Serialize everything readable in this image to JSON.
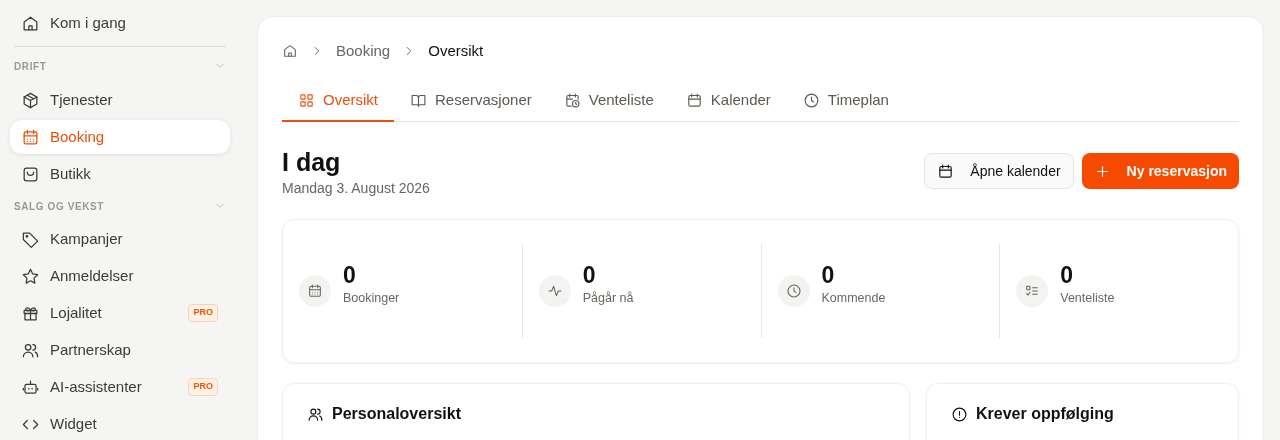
{
  "sidebar": {
    "top_items": [
      {
        "label": "Kom i gang",
        "selected": false
      }
    ],
    "sections": [
      {
        "heading": "DRIFT",
        "expanded": true,
        "items": [
          {
            "label": "Tjenester",
            "selected": false
          },
          {
            "label": "Booking",
            "selected": true
          },
          {
            "label": "Butikk",
            "selected": false
          }
        ]
      },
      {
        "heading": "SALG OG VEKST",
        "expanded": true,
        "items": [
          {
            "label": "Kampanjer",
            "selected": false
          },
          {
            "label": "Anmeldelser",
            "selected": false
          },
          {
            "label": "Lojalitet",
            "selected": false,
            "badge": "PRO"
          },
          {
            "label": "Partnerskap",
            "selected": false
          },
          {
            "label": "AI-assistenter",
            "selected": false,
            "badge": "PRO"
          },
          {
            "label": "Widget",
            "selected": false
          }
        ]
      }
    ]
  },
  "breadcrumb": [
    "Booking",
    "Oversikt"
  ],
  "tabs": [
    {
      "label": "Oversikt",
      "selected": true
    },
    {
      "label": "Reservasjoner",
      "selected": false
    },
    {
      "label": "Venteliste",
      "selected": false
    },
    {
      "label": "Kalender",
      "selected": false
    },
    {
      "label": "Timeplan",
      "selected": false
    }
  ],
  "header": {
    "title": "I dag",
    "date": "Mandag 3. August 2026",
    "buttons": [
      {
        "label": "Åpne kalender",
        "kind": "secondary"
      },
      {
        "label": "Ny reservasjon",
        "kind": "primary"
      }
    ]
  },
  "stats": [
    {
      "value": "0",
      "label": "Bookinger"
    },
    {
      "value": "0",
      "label": "Pågår nå"
    },
    {
      "value": "0",
      "label": "Kommende"
    },
    {
      "value": "0",
      "label": "Venteliste"
    }
  ],
  "panels": [
    {
      "title": "Personaloversikt"
    },
    {
      "title": "Krever oppfølging"
    }
  ]
}
